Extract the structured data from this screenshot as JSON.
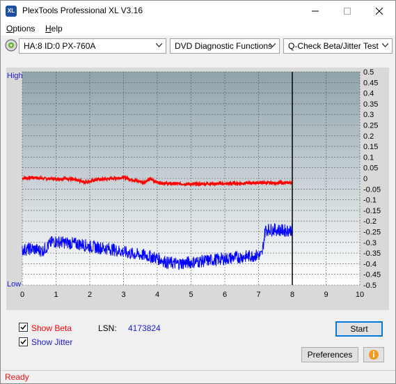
{
  "window": {
    "title": "PlexTools Professional XL V3.16",
    "app_icon_label": "XL"
  },
  "menu": [
    {
      "label": "Options"
    },
    {
      "label": "Help"
    }
  ],
  "toolbar": {
    "drive": "HA:8 ID:0  PX-760A",
    "function": "DVD Diagnostic Functions",
    "test": "Q-Check Beta/Jitter Test"
  },
  "chart_data": {
    "type": "line",
    "left_axis": {
      "top_label": "High",
      "bottom_label": "Low"
    },
    "x_ticks": [
      "0",
      "1",
      "2",
      "3",
      "4",
      "5",
      "6",
      "7",
      "8",
      "9",
      "10"
    ],
    "y_right_ticks": [
      "0.5",
      "0.45",
      "0.4",
      "0.35",
      "0.3",
      "0.25",
      "0.2",
      "0.15",
      "0.1",
      "0.05",
      "0",
      "-0.05",
      "-0.1",
      "-0.15",
      "-0.2",
      "-0.25",
      "-0.3",
      "-0.35",
      "-0.4",
      "-0.45",
      "-0.5"
    ],
    "xlim": [
      0,
      10
    ],
    "ylim": [
      -0.5,
      0.5
    ],
    "cursor_x": 8,
    "grid": true,
    "series": [
      {
        "color": "#ff0000",
        "x": [
          0,
          0.3,
          0.6,
          1.0,
          1.3,
          1.6,
          1.9,
          2.2,
          2.5,
          3.0,
          3.1,
          3.3,
          3.6,
          3.8,
          4.0,
          4.3,
          4.6,
          5.0,
          5.5,
          6.0,
          6.5,
          7.0,
          7.2,
          7.5,
          8.0
        ],
        "values": [
          0.0,
          0.005,
          0.0,
          -0.003,
          0.0,
          -0.008,
          -0.018,
          -0.005,
          -0.003,
          0.005,
          0.0,
          -0.008,
          -0.018,
          -0.003,
          -0.018,
          -0.025,
          -0.025,
          -0.027,
          -0.025,
          -0.025,
          -0.023,
          -0.02,
          -0.02,
          -0.022,
          -0.02
        ]
      },
      {
        "color": "#0000ff",
        "x": [
          0,
          0.3,
          0.6,
          0.8,
          0.9,
          1.2,
          1.5,
          1.8,
          2.0,
          2.3,
          2.6,
          3.0,
          3.3,
          3.6,
          3.9,
          4.1,
          4.3,
          4.6,
          4.9,
          5.2,
          5.5,
          5.8,
          6.1,
          6.4,
          6.7,
          7.0,
          7.1,
          7.2,
          7.5,
          7.8,
          8.0
        ],
        "values": [
          -0.335,
          -0.33,
          -0.34,
          -0.31,
          -0.295,
          -0.3,
          -0.305,
          -0.31,
          -0.32,
          -0.325,
          -0.33,
          -0.345,
          -0.355,
          -0.36,
          -0.37,
          -0.38,
          -0.395,
          -0.4,
          -0.395,
          -0.39,
          -0.385,
          -0.38,
          -0.375,
          -0.37,
          -0.365,
          -0.36,
          -0.36,
          -0.24,
          -0.24,
          -0.245,
          -0.24
        ]
      }
    ]
  },
  "bottom": {
    "show_beta": "Show Beta",
    "show_jitter": "Show Jitter",
    "lsn_label": "LSN:",
    "lsn_value": "4173824",
    "start": "Start",
    "preferences": "Preferences"
  },
  "status": {
    "text": "Ready"
  },
  "colors": {
    "beta": "#ff0000",
    "jitter": "#0000ff",
    "status": "#e11111",
    "accent": "#0078d7"
  }
}
